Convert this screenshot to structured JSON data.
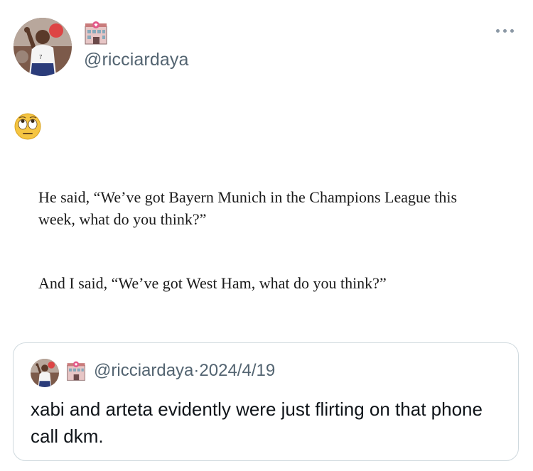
{
  "author": {
    "handle": "@ricciardaya",
    "avatar_icon": "footballer-avatar",
    "badge_icon": "love-hotel-emoji"
  },
  "tweet": {
    "emoji_icon": "face-with-rolling-eyes-emoji",
    "image_text": {
      "paragraph1": "He said, “We’ve got Bayern Munich in the Champions League this week, what do you think?”",
      "paragraph2": "And I said, “We’ve got West Ham, what do you think?”"
    }
  },
  "quoted_tweet": {
    "handle": "@ricciardaya",
    "separator": "·",
    "date": "2024/4/19",
    "text": "xabi and arteta evidently were just flirting on that phone call dkm."
  },
  "colors": {
    "handle_gray": "#536471",
    "border": "#cfd9de",
    "text": "#0f1419"
  }
}
